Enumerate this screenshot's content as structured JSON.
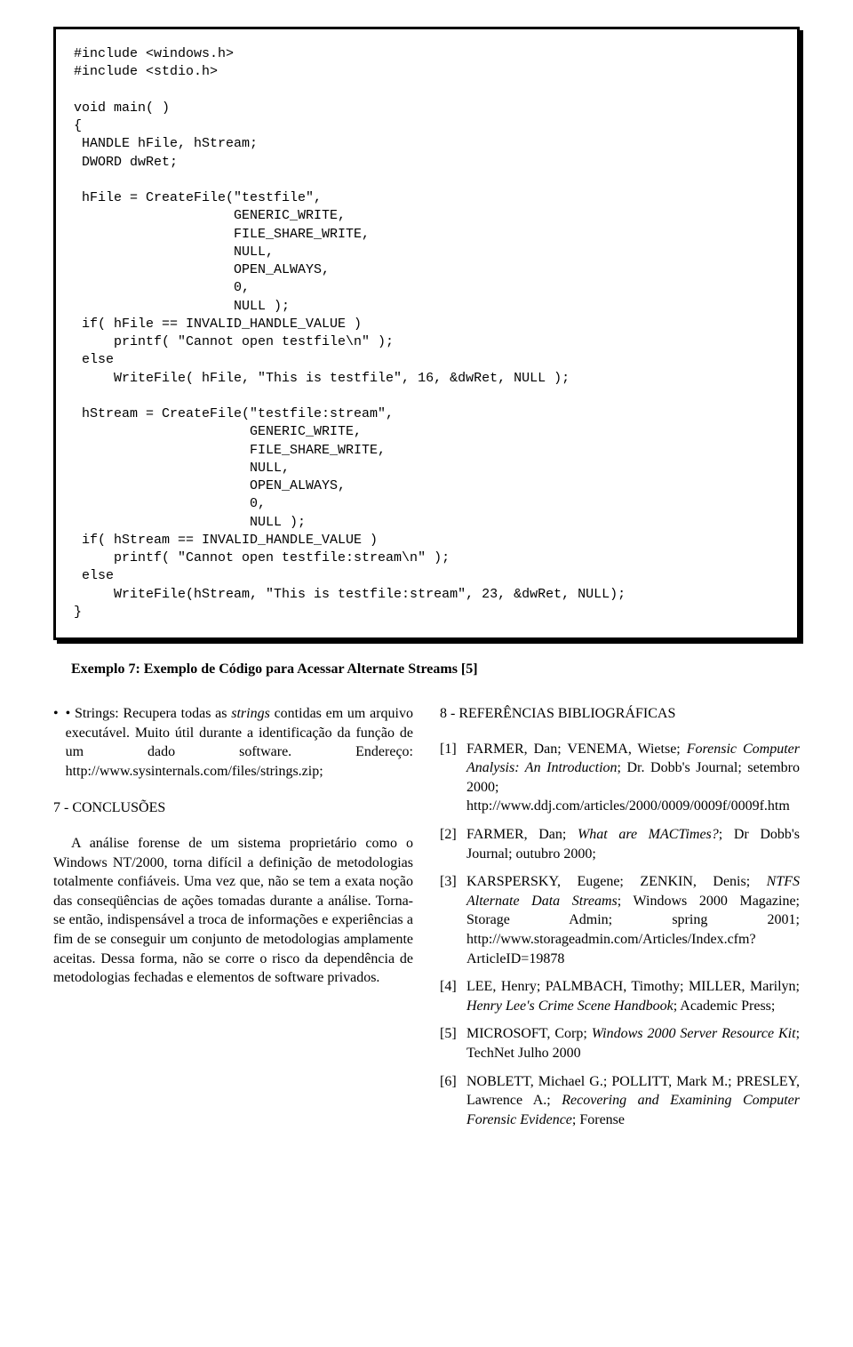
{
  "code": "#include <windows.h>\n#include <stdio.h>\n\nvoid main( )\n{\n HANDLE hFile, hStream;\n DWORD dwRet;\n\n hFile = CreateFile(\"testfile\",\n                    GENERIC_WRITE,\n                    FILE_SHARE_WRITE,\n                    NULL,\n                    OPEN_ALWAYS,\n                    0,\n                    NULL );\n if( hFile == INVALID_HANDLE_VALUE )\n     printf( \"Cannot open testfile\\n\" );\n else\n     WriteFile( hFile, \"This is testfile\", 16, &dwRet, NULL );\n\n hStream = CreateFile(\"testfile:stream\",\n                      GENERIC_WRITE,\n                      FILE_SHARE_WRITE,\n                      NULL,\n                      OPEN_ALWAYS,\n                      0,\n                      NULL );\n if( hStream == INVALID_HANDLE_VALUE )\n     printf( \"Cannot open testfile:stream\\n\" );\n else\n     WriteFile(hStream, \"This is testfile:stream\", 23, &dwRet, NULL);\n}",
  "caption": "Exemplo 7: Exemplo de Código para Acessar Alternate Streams [5]",
  "left": {
    "bullet_prefix": "• Strings: Recupera todas as ",
    "bullet_italic": "strings",
    "bullet_suffix": " contidas em um arquivo executável. Muito útil durante a identificação da função de um dado software. Endereço: http://www.sysinternals.com/files/strings.zip;",
    "section": "7 - CONCLUSÕES",
    "para": "A análise forense de um sistema proprietário como o Windows NT/2000, torna difícil a definição de metodologias totalmente confiáveis. Uma vez que, não se tem a exata noção das conseqüências de ações tomadas durante a análise. Torna-se então, indispensável a troca de informações e experiências a fim de se conseguir um conjunto de metodologias amplamente aceitas. Dessa forma, não se corre o risco da dependência de metodologias fechadas e elementos de software privados."
  },
  "right": {
    "section": "8 - REFERÊNCIAS BIBLIOGRÁFICAS",
    "refs": [
      {
        "n": "[1]",
        "pre": "FARMER, Dan; VENEMA, Wietse; ",
        "it": "Forensic Computer Analysis: An Introduction",
        "post": "; Dr. Dobb's Journal; setembro 2000; http://www.ddj.com/articles/2000/0009/0009f/0009f.htm"
      },
      {
        "n": "[2]",
        "pre": "FARMER, Dan; ",
        "it": "What are MACTimes?",
        "post": "; Dr Dobb's Journal; outubro 2000;"
      },
      {
        "n": "[3]",
        "pre": "KARSPERSKY, Eugene; ZENKIN, Denis; ",
        "it": "NTFS Alternate Data Streams",
        "post": "; Windows 2000 Magazine; Storage Admin; spring 2001; http://www.storageadmin.com/Articles/Index.cfm?ArticleID=19878"
      },
      {
        "n": "[4]",
        "pre": "LEE, Henry; PALMBACH, Timothy; MILLER, Marilyn;  ",
        "it": "Henry Lee's Crime Scene Handbook",
        "post": "; Academic Press;"
      },
      {
        "n": "[5]",
        "pre": "MICROSOFT, Corp; ",
        "it": "Windows 2000 Server Resource Kit",
        "post": "; TechNet Julho 2000"
      },
      {
        "n": "[6]",
        "pre": "NOBLETT, Michael G.; POLLITT, Mark M.; PRESLEY, Lawrence A.; ",
        "it": "Recovering and Examining Computer Forensic Evidence",
        "post": "; Forense"
      }
    ]
  }
}
